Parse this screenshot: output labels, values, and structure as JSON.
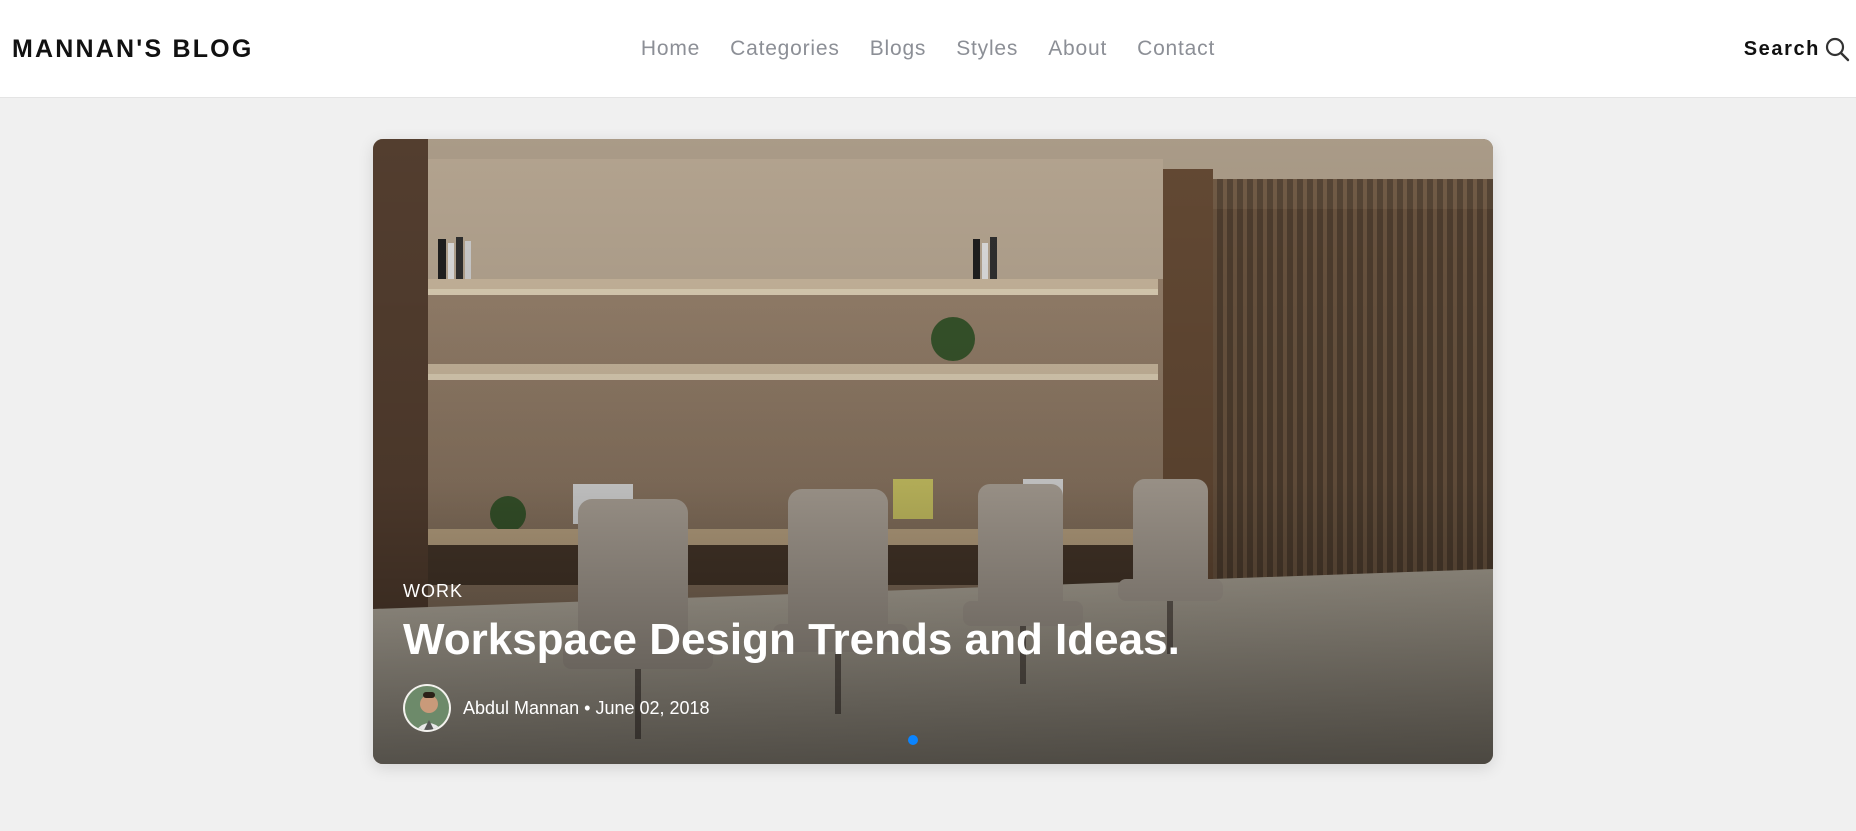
{
  "header": {
    "logo": "MANNAN'S BLOG",
    "nav": [
      "Home",
      "Categories",
      "Blogs",
      "Styles",
      "About",
      "Contact"
    ],
    "search_label": "Search"
  },
  "hero": {
    "category": "WORK",
    "title": "Workspace Design Trends and Ideas.",
    "author": "Abdul Mannan",
    "separator": "•",
    "date": "June 02, 2018",
    "active_slide": 1,
    "slide_count": 1
  },
  "colors": {
    "nav_text": "#8c8f96",
    "dot_active": "#0a84ff",
    "page_bg": "#f0f0f0"
  },
  "icons": {
    "search": "search-icon"
  }
}
